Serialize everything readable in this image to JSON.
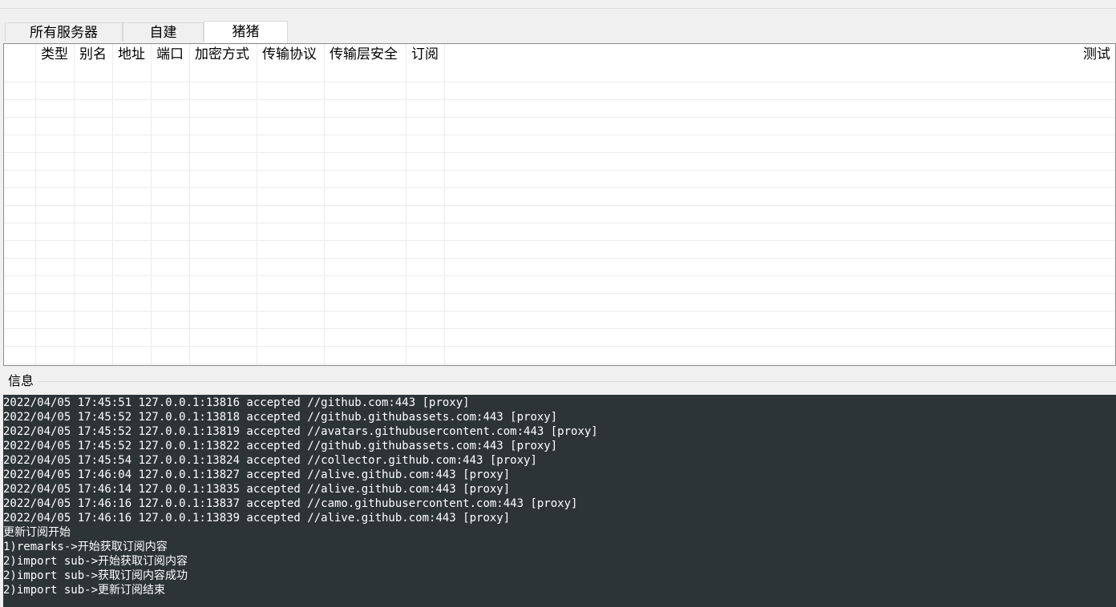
{
  "tabs": [
    "所有服务器",
    "自建",
    "猪猪"
  ],
  "active_tab_index": 2,
  "table": {
    "columns": [
      "",
      "类型",
      "别名",
      "地址",
      "端口",
      "加密方式",
      "传输协议",
      "传输层安全",
      "订阅",
      "测试"
    ],
    "rows": []
  },
  "info_label": "信息",
  "log_lines": [
    "2022/04/05 17:45:51 127.0.0.1:13816 accepted //github.com:443 [proxy]",
    "2022/04/05 17:45:52 127.0.0.1:13818 accepted //github.githubassets.com:443 [proxy]",
    "2022/04/05 17:45:52 127.0.0.1:13819 accepted //avatars.githubusercontent.com:443 [proxy]",
    "2022/04/05 17:45:52 127.0.0.1:13822 accepted //github.githubassets.com:443 [proxy]",
    "2022/04/05 17:45:54 127.0.0.1:13824 accepted //collector.github.com:443 [proxy]",
    "2022/04/05 17:46:04 127.0.0.1:13827 accepted //alive.github.com:443 [proxy]",
    "2022/04/05 17:46:14 127.0.0.1:13835 accepted //alive.github.com:443 [proxy]",
    "2022/04/05 17:46:16 127.0.0.1:13837 accepted //camo.githubusercontent.com:443 [proxy]",
    "2022/04/05 17:46:16 127.0.0.1:13839 accepted //alive.github.com:443 [proxy]",
    "更新订阅开始",
    "1)remarks->开始获取订阅内容",
    "2)import sub->开始获取订阅内容",
    "2)import sub->获取订阅内容成功",
    "2)import sub->更新订阅结束"
  ],
  "colors": {
    "log_background": "#2c3438",
    "log_text": "#ffffff",
    "grid_line": "#ececec"
  }
}
